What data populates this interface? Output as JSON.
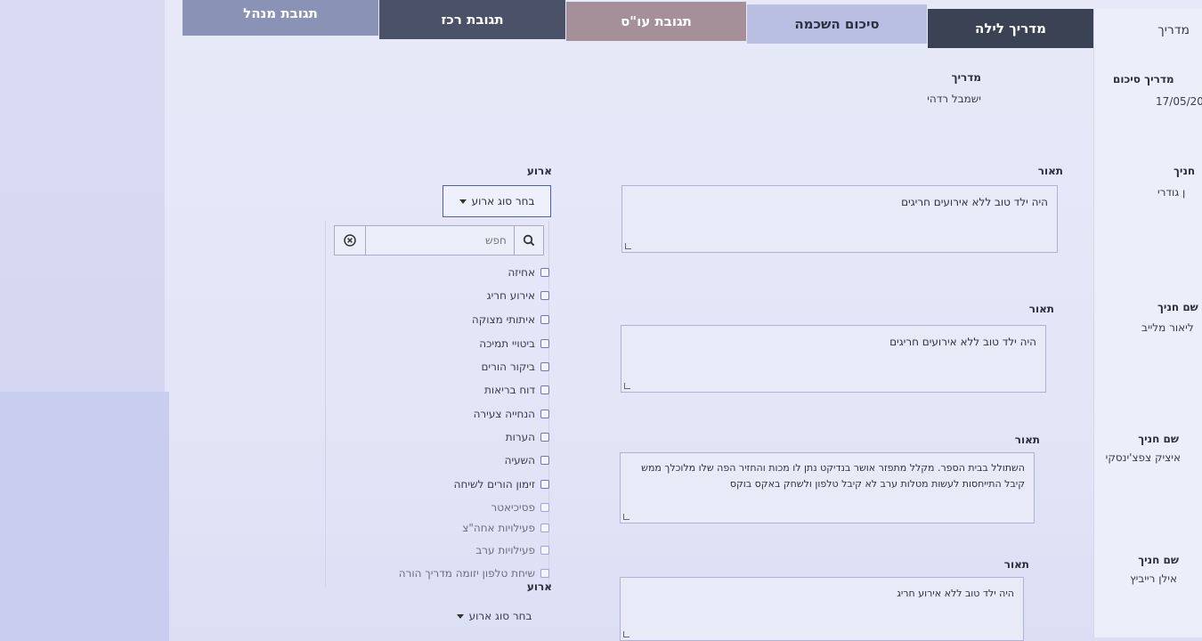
{
  "tabs": [
    {
      "label": "מדריך לילה",
      "active": true
    },
    {
      "label": "סיכום השכמה"
    },
    {
      "label": "תגובת עו\"ס"
    },
    {
      "label": "תגובת רכז"
    },
    {
      "label": "תגובת מנהל"
    }
  ],
  "right_column": {
    "header": "מדריך",
    "summary_label": "מדריך סיכום",
    "summary_date": "17/05/20",
    "student_label_1": "חניך",
    "student_value_1": "ן גודרי",
    "student_label_2": "שם חניך",
    "student_value_2": "ליאור מלייב",
    "student_label_3": "שם חניך",
    "student_value_3": "איציק צפצ'ינסקי",
    "student_label_4": "שם חניך",
    "student_value_4": "אילן רייביץ"
  },
  "guide": {
    "label": "מדריך",
    "value": "ישמבל רדהי"
  },
  "descriptions": [
    {
      "label": "תאור",
      "text": "היה ילד טוב ללא אירועים חריגים"
    },
    {
      "label": "תאור",
      "text": "היה ילד טוב ללא אירועים חריגים"
    },
    {
      "label": "תאור",
      "text": "השתולל בבית הספר. מקלל מתפזר אושר בנדיקט נתן לו מכות והחזיר הפה שלו מלוכלך ממש קיבל התייחסות לעשות מטלות ערב לא קיבל טלפון ולשחק באקס בוקס"
    },
    {
      "label": "תאור",
      "text": "היה ילד טוב ללא אירוע חריג"
    }
  ],
  "event": {
    "label": "ארוע",
    "select_label": "בחר סוג ארוע",
    "search_placeholder": "חפש",
    "options": [
      "אחיזה",
      "אירוע חריג",
      "איתותי מצוקה",
      "ביטויי תמיכה",
      "ביקור הורים",
      "דוח בריאות",
      "הנחייה צעירה",
      "הערות",
      "השעיה",
      "זימון הורים לשיחה",
      "פסיכיאטר",
      "פעילויות אחה\"צ",
      "פעילויות ערב",
      "שיחת טלפון יזומה מדריך הורה"
    ]
  },
  "event2": {
    "label": "ארוע",
    "select_label": "בחר סוג ארוע"
  },
  "icons": {
    "search": "search-icon",
    "clear": "clear-circle-icon",
    "caret": "caret-down-icon"
  }
}
